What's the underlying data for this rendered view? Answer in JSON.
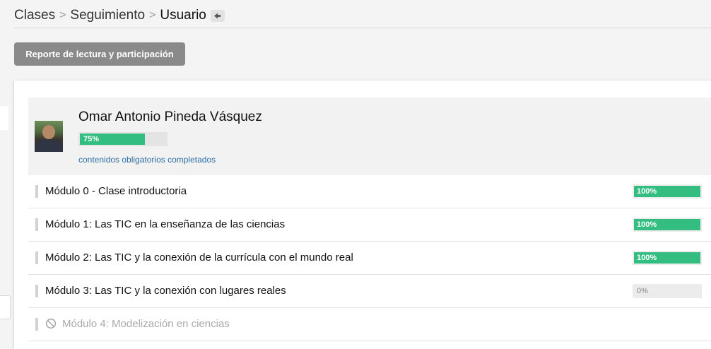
{
  "breadcrumb": {
    "items": [
      "Clases",
      "Seguimiento"
    ],
    "separator": ">",
    "current": "Usuario"
  },
  "toolbar": {
    "report_label": "Reporte de lectura y participación"
  },
  "user": {
    "name": "Omar Antonio Pineda Vásquez",
    "progress_label": "75%",
    "progress_fraction": 0.75,
    "caption": "contenidos obligatorios completados"
  },
  "modules": [
    {
      "title": "Módulo 0 - Clase introductoria",
      "progress_label": "100%",
      "progress_fraction": 1.0
    },
    {
      "title": "Módulo 1: Las TIC en la enseñanza de las ciencias",
      "progress_label": "100%",
      "progress_fraction": 1.0
    },
    {
      "title": "Módulo 2: Las TIC y la conexión de la currícula con el mundo real",
      "progress_label": "100%",
      "progress_fraction": 1.0
    },
    {
      "title": "Módulo 3: Las TIC y la conexión con lugares reales",
      "progress_label": "0%",
      "progress_fraction": 0.0
    },
    {
      "title": "Módulo 4: Modelización en ciencias",
      "locked": true,
      "icon": "blocked-icon"
    }
  ],
  "colors": {
    "progress": "#34bd80",
    "button": "#8a8a8a",
    "link": "#2f6ea3"
  }
}
